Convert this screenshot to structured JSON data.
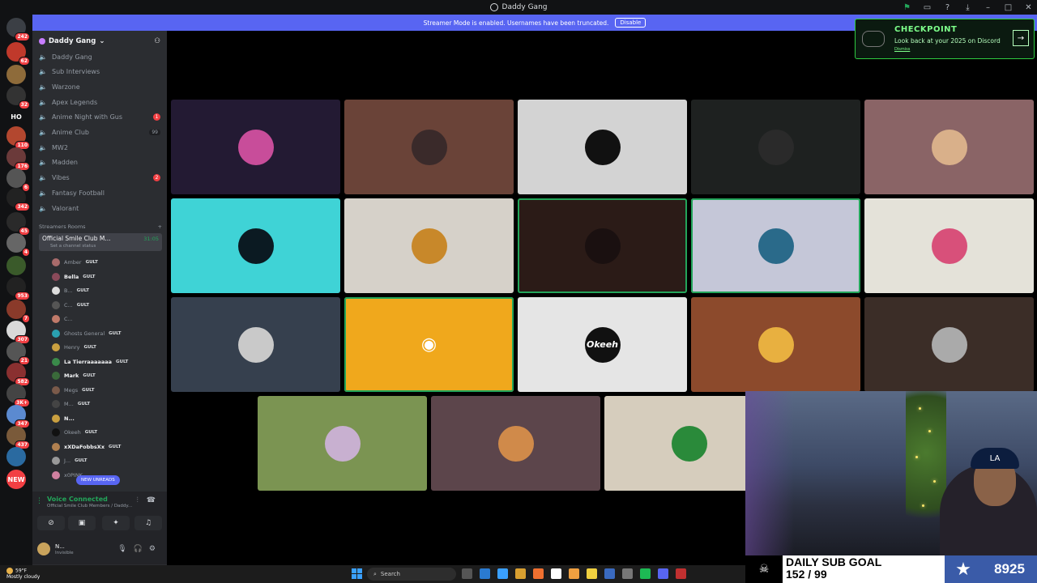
{
  "window": {
    "title": "Daddy Gang"
  },
  "banner": {
    "text": "Streamer Mode is enabled. Usernames have been truncated.",
    "button": "Disable"
  },
  "rail": {
    "servers": [
      {
        "label": "",
        "badge": "242",
        "color": "#3b3f45"
      },
      {
        "label": "",
        "badge": "62",
        "color": "#c0392b"
      },
      {
        "label": "",
        "badge": "",
        "color": "#8e6b3a"
      },
      {
        "label": "",
        "badge": "32",
        "color": "#333"
      },
      {
        "label": "HO",
        "badge": "",
        "color": "transparent"
      },
      {
        "label": "",
        "badge": "110",
        "color": "#b3472f"
      },
      {
        "label": "",
        "badge": "176",
        "color": "#6b3a3a"
      },
      {
        "label": "",
        "badge": "6",
        "color": "#555"
      },
      {
        "label": "",
        "badge": "342",
        "color": "#222"
      },
      {
        "label": "",
        "badge": "45",
        "color": "#2a2a2a"
      },
      {
        "label": "",
        "badge": "4",
        "color": "#666"
      },
      {
        "label": "",
        "badge": "",
        "color": "#3a5a2a"
      },
      {
        "label": "",
        "badge": "953",
        "color": "#222"
      },
      {
        "label": "",
        "badge": "7",
        "color": "#8a3a2a"
      },
      {
        "label": "",
        "badge": "307",
        "color": "#d9d9d9"
      },
      {
        "label": "",
        "badge": "21",
        "color": "#555"
      },
      {
        "label": "",
        "badge": "582",
        "color": "#8a3030"
      },
      {
        "label": "",
        "badge": "3K+",
        "color": "#444"
      },
      {
        "label": "",
        "badge": "347",
        "color": "#5b8ad0"
      },
      {
        "label": "",
        "badge": "437",
        "color": "#7a5a3a"
      },
      {
        "label": "",
        "badge": "",
        "color": "#2a6aa0"
      },
      {
        "label": "NEW",
        "badge": "",
        "color": "#f23f43"
      }
    ]
  },
  "sidebar": {
    "server_name": "Daddy Gang",
    "channels": [
      {
        "name": "Daddy Gang",
        "badge": ""
      },
      {
        "name": "Sub Interviews",
        "badge": ""
      },
      {
        "name": "Warzone",
        "badge": ""
      },
      {
        "name": "Apex Legends",
        "badge": ""
      },
      {
        "name": "Anime Night with Gus",
        "badge": "1"
      },
      {
        "name": "Anime Club",
        "badge": "",
        "count": "99"
      },
      {
        "name": "MW2",
        "badge": ""
      },
      {
        "name": "Madden",
        "badge": ""
      },
      {
        "name": "Vibes",
        "badge": "2"
      },
      {
        "name": "Fantasy Football",
        "badge": ""
      },
      {
        "name": "Valorant",
        "badge": ""
      }
    ],
    "category": "Streamers Rooms",
    "active_channel": {
      "name": "Official Smile Club M...",
      "timer": "31:05",
      "status": "Set a channel status"
    },
    "members": [
      {
        "name": "Amber",
        "tag": "GULT",
        "bold": false,
        "color": "#a86b6b"
      },
      {
        "name": "Bella",
        "tag": "GULT",
        "bold": true,
        "color": "#8a4a5a"
      },
      {
        "name": "B...",
        "tag": "GULT",
        "bold": false,
        "color": "#ddd"
      },
      {
        "name": "C...",
        "tag": "GULT",
        "bold": false,
        "color": "#555"
      },
      {
        "name": "C...",
        "tag": "",
        "bold": false,
        "color": "#c07a6a"
      },
      {
        "name": "Ghosts General",
        "tag": "GULT",
        "bold": false,
        "color": "#2aa0b0"
      },
      {
        "name": "Henry",
        "tag": "GULT",
        "bold": false,
        "color": "#caa040"
      },
      {
        "name": "La Tierraaaaaaa",
        "tag": "GULT",
        "bold": true,
        "color": "#3a8a4a"
      },
      {
        "name": "Mark",
        "tag": "GULT",
        "bold": true,
        "color": "#3a6a3a"
      },
      {
        "name": "Megs",
        "tag": "GULT",
        "bold": false,
        "color": "#7a5a4a"
      },
      {
        "name": "M...",
        "tag": "GULT",
        "bold": false,
        "color": "#444"
      },
      {
        "name": "N...",
        "tag": "",
        "bold": true,
        "color": "#caa040"
      },
      {
        "name": "Okeeh",
        "tag": "GULT",
        "bold": false,
        "color": "#111"
      },
      {
        "name": "xXDaFobbsXx",
        "tag": "GULT",
        "bold": true,
        "color": "#b08050"
      },
      {
        "name": "J...",
        "tag": "GULT",
        "bold": false,
        "color": "#999"
      },
      {
        "name": "x0PINK...",
        "tag": "",
        "bold": false,
        "color": "#d080a0"
      }
    ],
    "new_unreads": "NEW UNREADS"
  },
  "voice": {
    "status": "Voice Connected",
    "channel": "Official Smile Club Members / Daddy...",
    "user_name": "N...",
    "user_status": "Invisible"
  },
  "grid": {
    "tiles": [
      {
        "bg": "#231a33",
        "av": "#c84d9a",
        "speaking": false
      },
      {
        "bg": "#6a4338",
        "av": "#3a2a2a",
        "speaking": false
      },
      {
        "bg": "#d3d3d3",
        "av": "#111",
        "speaking": false
      },
      {
        "bg": "#1e2120",
        "av": "#2a2a2a",
        "speaking": false
      },
      {
        "bg": "#8a6466",
        "av": "#d9b08a",
        "speaking": false
      },
      {
        "bg": "#3fd3d6",
        "av": "#0b1a22",
        "speaking": false
      },
      {
        "bg": "#d6d1c9",
        "av": "#c8882a",
        "speaking": false
      },
      {
        "bg": "#2b1b17",
        "av": "#1a1010",
        "speaking": true
      },
      {
        "bg": "#c5c7d8",
        "av": "#2a6a8a",
        "speaking": true
      },
      {
        "bg": "#e4e2d9",
        "av": "#d8507a",
        "speaking": false
      },
      {
        "bg": "#36404e",
        "av": "#c9c9c9",
        "speaking": false
      },
      {
        "bg": "#f0a81c",
        "av": "#f0a81c",
        "speaking": true,
        "discord": true
      },
      {
        "bg": "#e5e5e5",
        "av": "#111",
        "speaking": false,
        "label": "Okeeh"
      },
      {
        "bg": "#8c4a2c",
        "av": "#e8b040",
        "speaking": false
      },
      {
        "bg": "#3b2d27",
        "av": "#aaa",
        "speaking": false
      },
      {
        "bg": "#7b9452",
        "av": "#c8b0d0",
        "speaking": false
      },
      {
        "bg": "#5c454b",
        "av": "#d08a4a",
        "speaking": false
      },
      {
        "bg": "#d6cdbd",
        "av": "#2a8a3a",
        "speaking": false
      }
    ]
  },
  "checkpoint": {
    "title": "CHECKPOINT",
    "subtitle": "Look back at your 2025 on Discord",
    "dismiss": "Dismiss"
  },
  "sub_goal": {
    "label": "DAILY SUB GOAL",
    "progress": "152 / 99",
    "count": "8925"
  },
  "taskbar": {
    "weather_temp": "59°F",
    "weather_desc": "Mostly cloudy",
    "search": "Search"
  }
}
